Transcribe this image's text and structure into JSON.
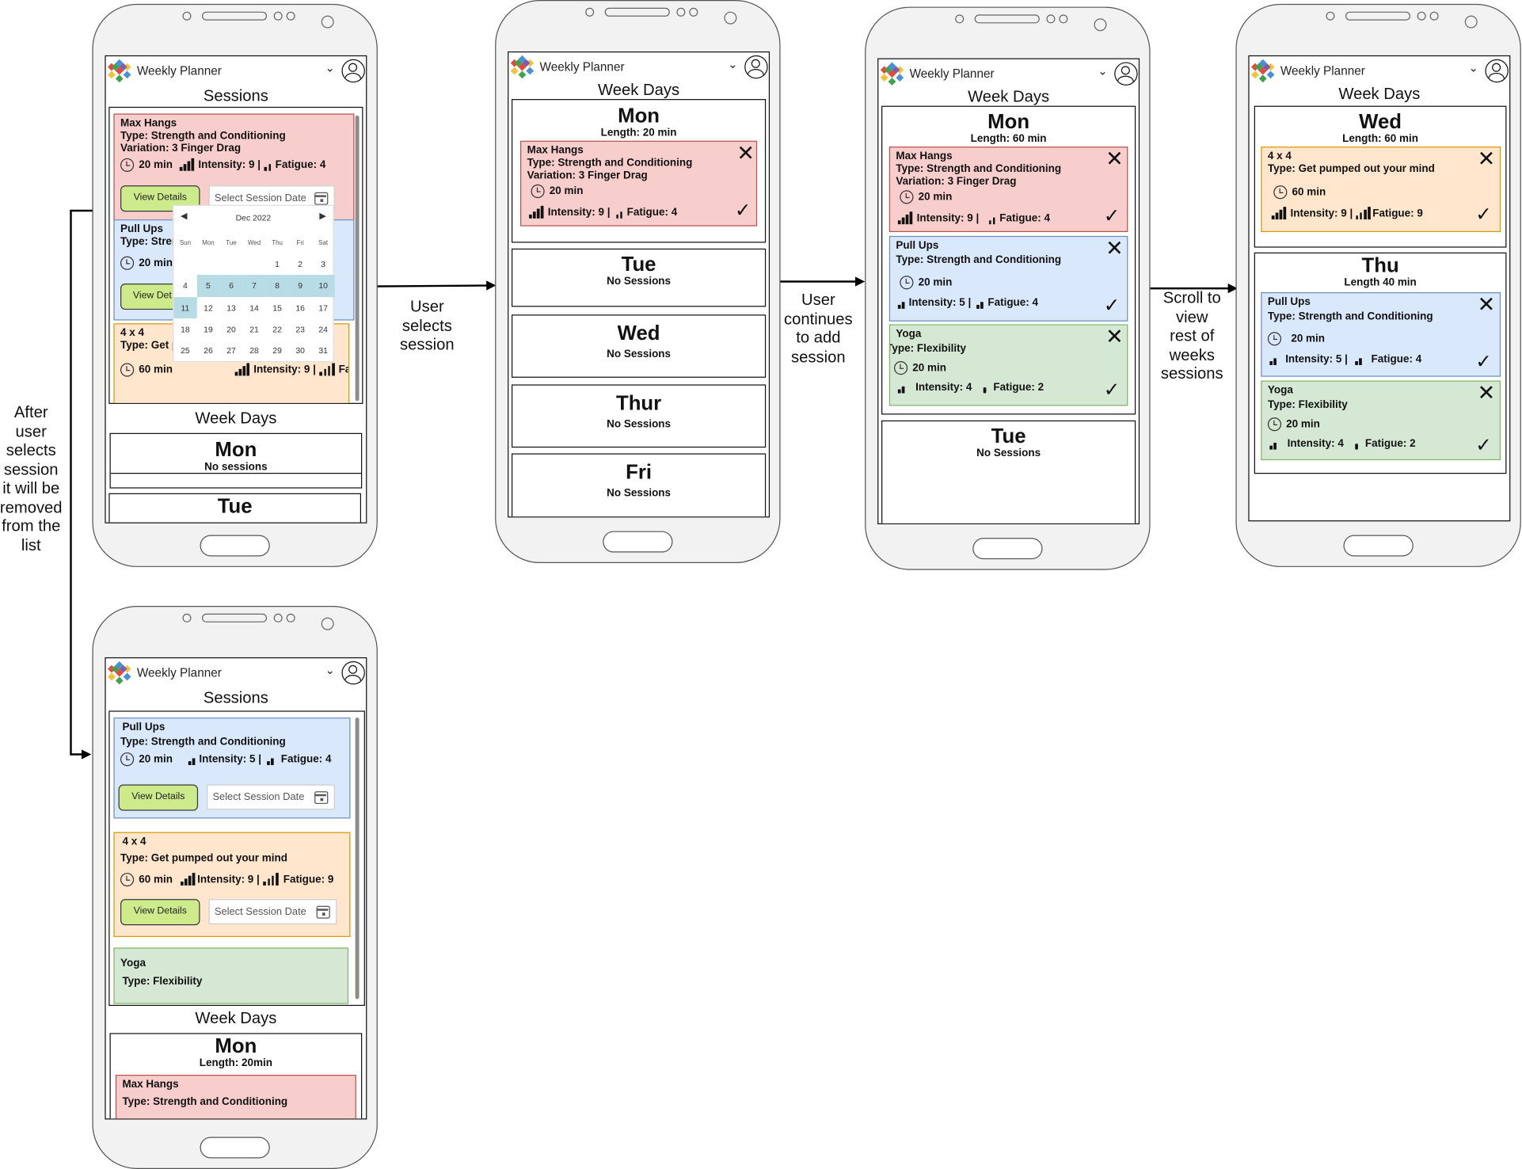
{
  "app": {
    "title": "Weekly Planner",
    "chevron": "⌄"
  },
  "colors": {
    "red_fill": "#f8cecc",
    "blue_fill": "#dae8fc",
    "orange_fill": "#ffe6cc",
    "green_fill": "#d5e8d4",
    "view_details_fill": "#cdeb8b"
  },
  "labels": {
    "sessions": "Sessions",
    "week_days": "Week Days",
    "view_details": "View Details",
    "select_date": "Select Session Date",
    "no_sessions_lower": "No sessions",
    "no_sessions": "No Sessions"
  },
  "annotations": {
    "a1": "User\nselects\nsession",
    "a2": "User\ncontinues\nto add\nsession",
    "a3": "Scroll to\nview\nrest of\nweeks\nsessions",
    "a4": "After\nuser\nselects\nsession\nit will be\nremoved\nfrom the\nlist"
  },
  "calendar": {
    "month": "Dec 2022",
    "prev": "◀",
    "next": "▶",
    "weekdays": [
      "Sun",
      "Mon",
      "Tue",
      "Wed",
      "Thu",
      "Fri",
      "Sat"
    ],
    "rows": [
      [
        "",
        "",
        "",
        "",
        "1",
        "2",
        "3"
      ],
      [
        "4",
        "5",
        "6",
        "7",
        "8",
        "9",
        "10"
      ],
      [
        "11",
        "12",
        "13",
        "14",
        "15",
        "16",
        "17"
      ],
      [
        "18",
        "19",
        "20",
        "21",
        "22",
        "23",
        "24"
      ],
      [
        "25",
        "26",
        "27",
        "28",
        "29",
        "30",
        "31"
      ]
    ]
  },
  "sessions": {
    "max_hangs": {
      "title": "Max Hangs",
      "type": "Type: Strength and Conditioning",
      "variation": "Variation: 3 Finger Drag",
      "duration": "20 min",
      "intensity": "Intensity: 9 |",
      "fatigue": "Fatigue: 4"
    },
    "pull_ups": {
      "title": "Pull Ups",
      "type": "Type: Strength and Conditioning",
      "type_partial": "Type: Stren",
      "duration": "20 min",
      "intensity": "Intensity: 5 |",
      "fatigue": "Fatigue: 4",
      "view_partial": "View Det"
    },
    "four_by_four": {
      "title": "4 x 4",
      "type": "Type: Get pumped out your mind",
      "type_partial": "Type: Get p",
      "duration": "60 min",
      "intensity": "Intensity: 9 |",
      "intensity_compact": "Intensity: 9 |",
      "fatigue": "Fatigue: 9",
      "fatigue_compact": "Fatigue: 9"
    },
    "yoga": {
      "title": "Yoga",
      "type": "Type: Flexibility",
      "duration": "20 min",
      "intensity": "Intensity: 4",
      "fatigue": "Fatigue: 2"
    }
  },
  "screen1": {
    "days": {
      "mon": "Mon",
      "mon_sub": "No sessions",
      "tue": "Tue"
    }
  },
  "screen2": {
    "mon": "Mon",
    "mon_len": "Length: 20 min",
    "tue": "Tue",
    "wed": "Wed",
    "thur": "Thur",
    "fri": "Fri",
    "no_sessions": "No Sessions"
  },
  "screen3": {
    "mon": "Mon",
    "mon_len": "Length: 60 min",
    "tue": "Tue",
    "tue_sub": "No Sessions"
  },
  "screen4": {
    "wed": "Wed",
    "wed_len": "Length: 60 min",
    "thu": "Thu",
    "thu_len": "Length 40 min"
  },
  "screen5": {
    "mon": "Mon",
    "mon_len": "Length: 20min"
  },
  "marks": {
    "close": "✕",
    "done": "✓"
  }
}
